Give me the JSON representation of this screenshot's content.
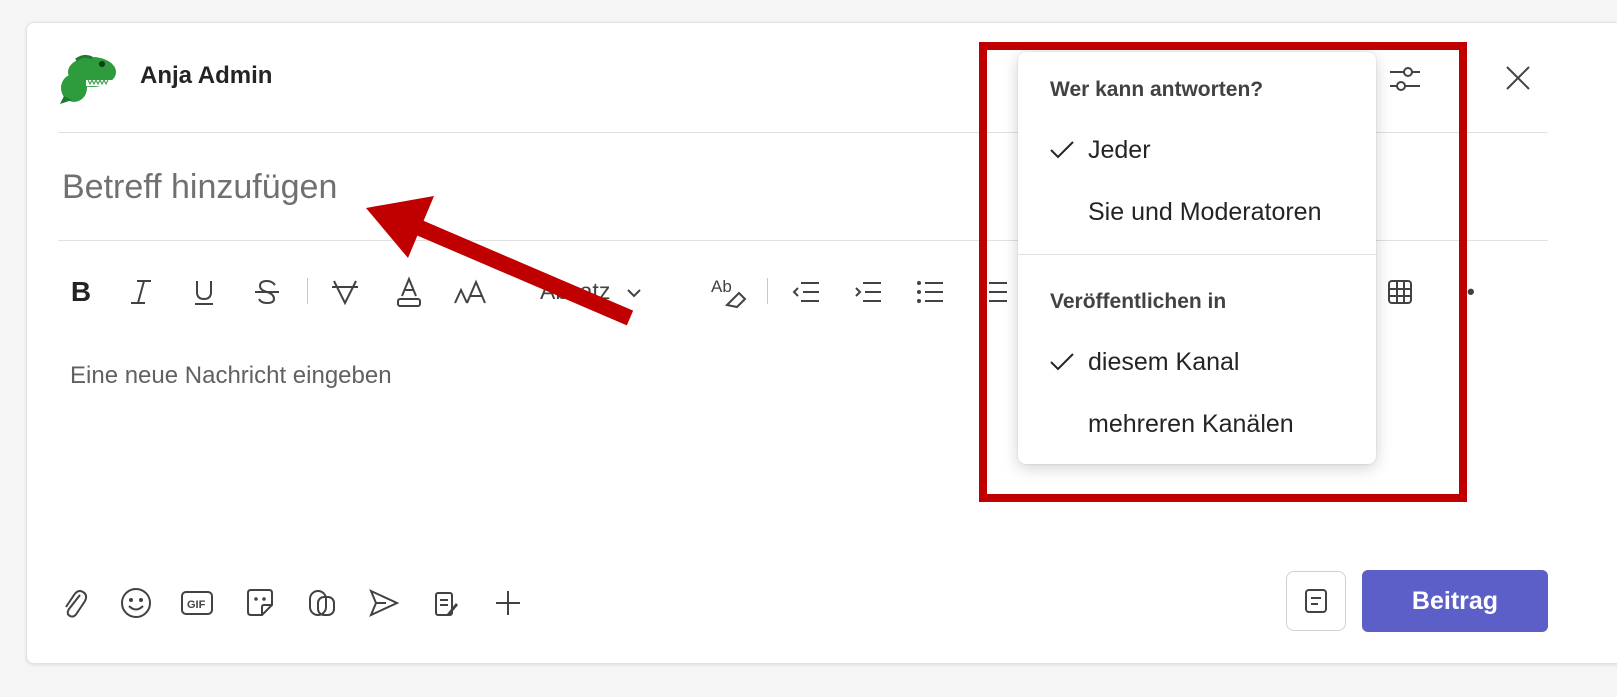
{
  "composer": {
    "author_name": "Anja Admin",
    "subject_placeholder": "Betreff hinzufügen",
    "message_placeholder": "Eine neue Nachricht eingeben",
    "paragraph_label": "Absatz",
    "post_label": "Beitrag"
  },
  "menu": {
    "section1_title": "Wer kann antworten?",
    "section1_items": [
      {
        "label": "Jeder",
        "checked": true
      },
      {
        "label": "Sie und Moderatoren",
        "checked": false
      }
    ],
    "section2_title": "Veröffentlichen in",
    "section2_items": [
      {
        "label": "diesem Kanal",
        "checked": true
      },
      {
        "label": "mehreren Kanälen",
        "checked": false
      }
    ]
  },
  "toolbar_icons": [
    "bold-icon",
    "italic-icon",
    "underline-icon",
    "strikethrough-icon",
    "highlight-icon",
    "font-color-icon",
    "font-size-icon",
    "paragraph-dropdown",
    "clear-format-icon",
    "decrease-indent-icon",
    "increase-indent-icon",
    "bulleted-list-icon",
    "numbered-list-icon",
    "table-icon",
    "more-options-icon"
  ],
  "bottom_icons": [
    "attach-icon",
    "emoji-icon",
    "gif-icon",
    "sticker-icon",
    "loop-icon",
    "send-icon",
    "praise-icon",
    "plus-icon",
    "format-toggle-icon"
  ],
  "colors": {
    "accent": "#5b5fc7",
    "highlight": "#c00000",
    "text_muted": "#707070"
  }
}
